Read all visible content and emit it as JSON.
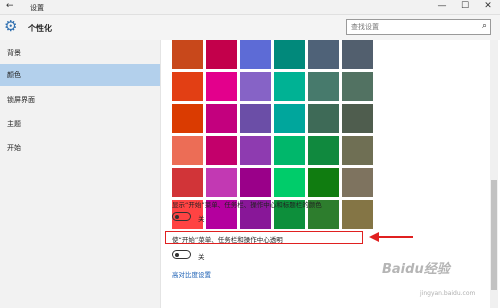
{
  "window": {
    "title": "设置",
    "back_glyph": "←",
    "minimize_glyph": "—",
    "maximize_glyph": "☐",
    "close_glyph": "✕"
  },
  "header": {
    "section_title": "个性化",
    "search_placeholder": "查找设置",
    "search_glyph": "⌕",
    "gear_glyph": "⚙"
  },
  "sidebar": {
    "items": [
      {
        "label": "背景",
        "active": false
      },
      {
        "label": "颜色",
        "active": true
      },
      {
        "label": "锁屏界面",
        "active": false
      },
      {
        "label": "主题",
        "active": false
      },
      {
        "label": "开始",
        "active": false
      }
    ],
    "active_color": "#b3d0ec"
  },
  "color_grid": {
    "rows": [
      [
        "#c8481b",
        "#c3004b",
        "#5d6bd6",
        "#01897b",
        "#4f6278",
        "#525f6e"
      ],
      [
        "#e23f14",
        "#e3008c",
        "#8663c6",
        "#00b294",
        "#477a6c",
        "#527262"
      ],
      [
        "#da3b01",
        "#c3007e",
        "#6b4ea7",
        "#00a69c",
        "#3e6a57",
        "#4f5d4e"
      ],
      [
        "#ec6d56",
        "#c3006b",
        "#8e3bb0",
        "#00b76b",
        "#10893e",
        "#6f6f54"
      ],
      [
        "#d13438",
        "#c239b3",
        "#9a0089",
        "#00cc6a",
        "#107c10",
        "#7e735f"
      ],
      [
        "#ff4343",
        "#b4009e",
        "#881798",
        "#0d8f3b",
        "#2d7d2d",
        "#847545"
      ]
    ]
  },
  "settings": {
    "show_color_label": "显示“开始”菜单、任务栏、操作中心和标题栏的颜色",
    "show_color_state": "关",
    "transparency_label": "使“开始”菜单、任务栏和操作中心透明",
    "transparency_state": "关",
    "high_contrast_link": "高对比度设置"
  },
  "watermark": {
    "text": "Baidu经验",
    "subtext": "jingyan.baidu.com"
  },
  "colors": {
    "annotation_red": "#e02020",
    "link_blue": "#1a5fb4",
    "gear_blue": "#2f6fb0"
  }
}
